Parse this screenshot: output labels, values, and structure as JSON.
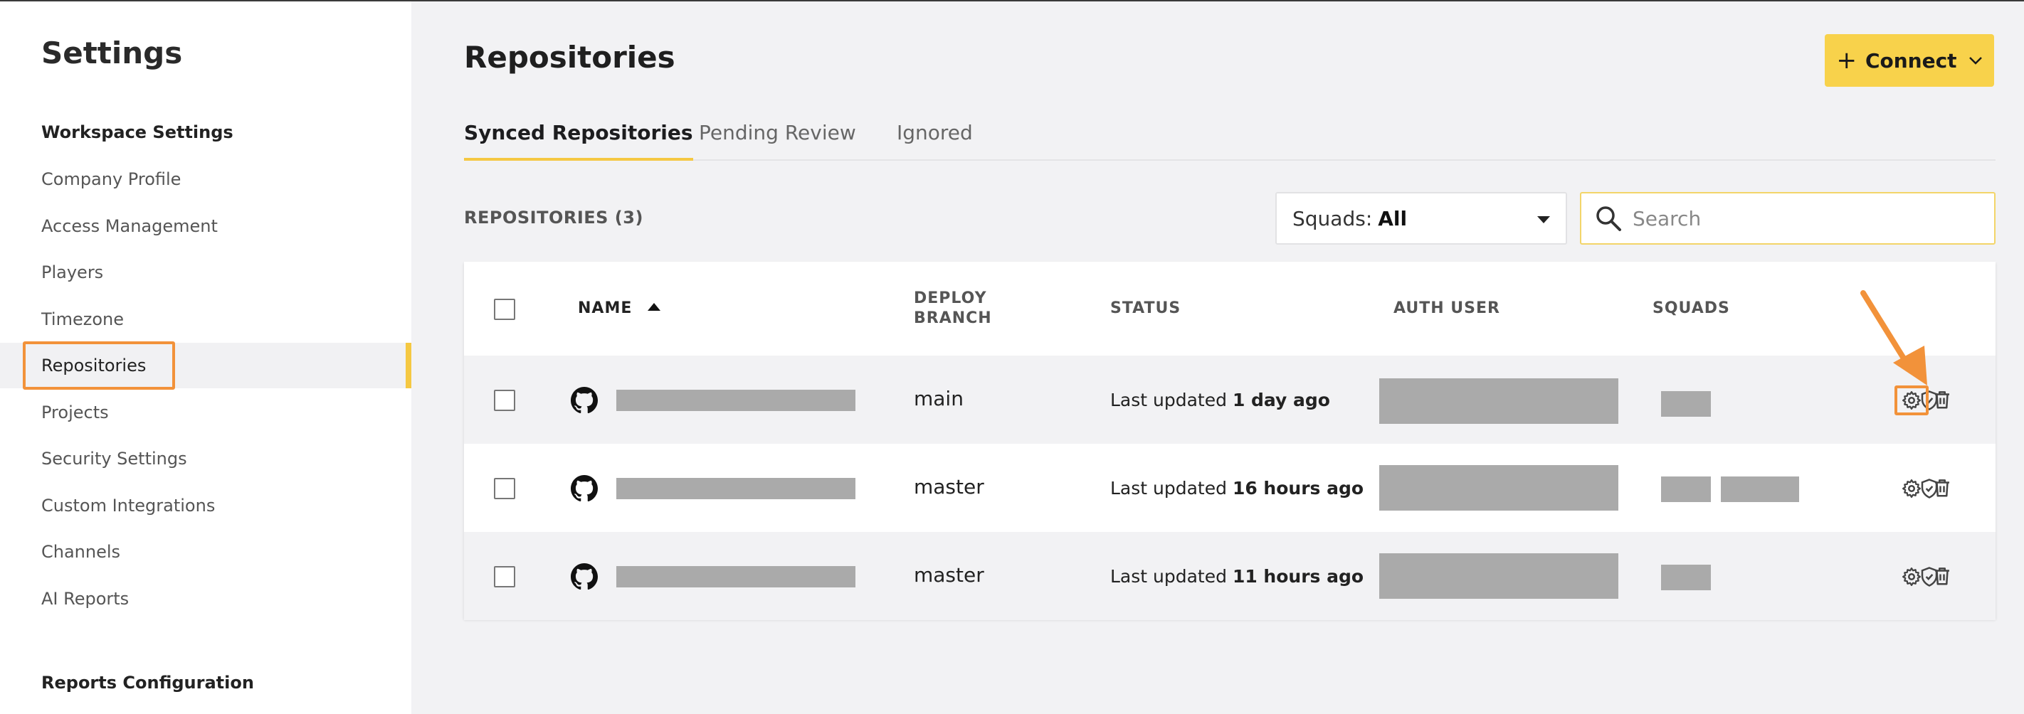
{
  "sidebar": {
    "title": "Settings",
    "sections": [
      {
        "label": "Workspace Settings"
      },
      {
        "label": "Reports Configuration"
      }
    ],
    "items": [
      {
        "label": "Company Profile"
      },
      {
        "label": "Access Management"
      },
      {
        "label": "Players"
      },
      {
        "label": "Timezone"
      },
      {
        "label": "Repositories"
      },
      {
        "label": "Projects"
      },
      {
        "label": "Security Settings"
      },
      {
        "label": "Custom Integrations"
      },
      {
        "label": "Channels"
      },
      {
        "label": "AI Reports"
      }
    ],
    "active_item": "Repositories"
  },
  "header": {
    "title": "Repositories",
    "connect_button": {
      "label": "Connect",
      "icon": "plus-icon",
      "chevron": "chevron-down-icon"
    }
  },
  "tabs": [
    {
      "label": "Synced Repositories",
      "active": true
    },
    {
      "label": "Pending Review",
      "active": false
    },
    {
      "label": "Ignored",
      "active": false
    }
  ],
  "toolbar": {
    "count_label": "REPOSITORIES (3)",
    "squad_filter_prefix": "Squads:",
    "squad_filter_value": "All",
    "search_placeholder": "Search"
  },
  "table": {
    "columns": {
      "name": "NAME",
      "deploy_branch_1": "DEPLOY",
      "deploy_branch_2": "BRANCH",
      "status": "STATUS",
      "auth_user": "AUTH USER",
      "squads": "SQUADS"
    },
    "rows": [
      {
        "branch": "main",
        "status_prefix": "Last updated",
        "status_time": "1 day ago"
      },
      {
        "branch": "master",
        "status_prefix": "Last updated",
        "status_time": "16 hours ago"
      },
      {
        "branch": "master",
        "status_prefix": "Last updated",
        "status_time": "11 hours ago"
      }
    ]
  },
  "colors": {
    "accent_yellow": "#f8d24b",
    "highlight_orange": "#f2923a",
    "redacted_gray": "#aaaaaa"
  }
}
